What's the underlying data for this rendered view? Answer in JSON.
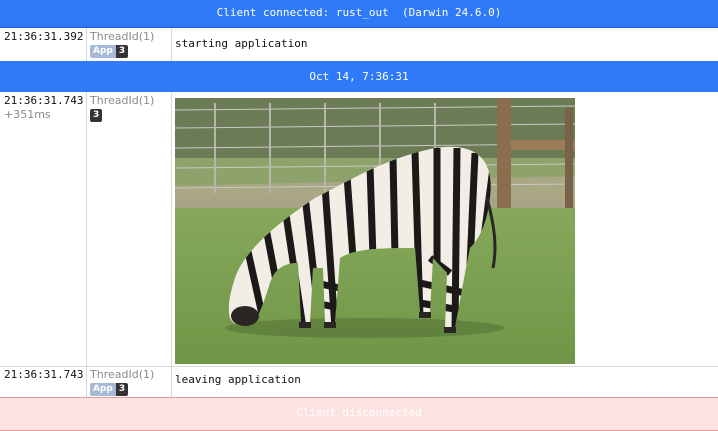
{
  "header": {
    "connected_text": "Client connected: rust_out  (Darwin 24.6.0)"
  },
  "date_separator": "Oct 14, 7:36:31",
  "footer": {
    "disconnected_text": "Client disconnected"
  },
  "rows": [
    {
      "time": "21:36:31.392",
      "delta": "",
      "thread": "ThreadId(1)",
      "badge_app": "App",
      "badge_num": "3",
      "message": "starting application"
    },
    {
      "time": "21:36:31.743",
      "delta": "+351ms",
      "thread": "ThreadId(1)",
      "badge_app": "",
      "badge_num": "3",
      "message": "",
      "image": "zebra-grazing-photo"
    },
    {
      "time": "21:36:31.743",
      "delta": "",
      "thread": "ThreadId(1)",
      "badge_app": "App",
      "badge_num": "3",
      "message": "leaving application"
    }
  ],
  "colors": {
    "accent_blue": "#2f7af8",
    "disconnect_bg": "#fde2e2",
    "disconnect_border": "#e79a9a"
  }
}
